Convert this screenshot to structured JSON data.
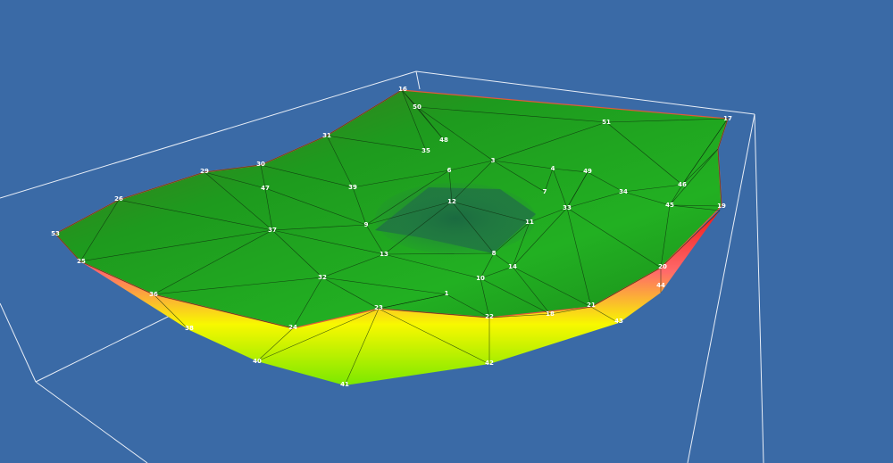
{
  "viewport": {
    "background": "#3a6aa6",
    "bounding_box_color": "#e8eef7",
    "mesh_line_color": "#0d2a0d"
  },
  "surface": {
    "top_colors": [
      "#1a8a1a",
      "#2ab52a",
      "#5a6a2a"
    ],
    "depression_color": "#1f6a4a",
    "side_colors": [
      "#f02020",
      "#ff5050",
      "#f4f000",
      "#8cf000"
    ],
    "rim_color": "#e05a3a"
  },
  "node_labels": [
    "1",
    "3",
    "4",
    "6",
    "7",
    "8",
    "9",
    "10",
    "11",
    "12",
    "13",
    "14",
    "16",
    "17",
    "18",
    "19",
    "20",
    "21",
    "22",
    "23",
    "24",
    "25",
    "26",
    "29",
    "30",
    "31",
    "32",
    "33",
    "34",
    "35",
    "36",
    "37",
    "38",
    "39",
    "40",
    "41",
    "42",
    "43",
    "44",
    "45",
    "46",
    "47",
    "48",
    "49",
    "50",
    "51",
    "53"
  ]
}
